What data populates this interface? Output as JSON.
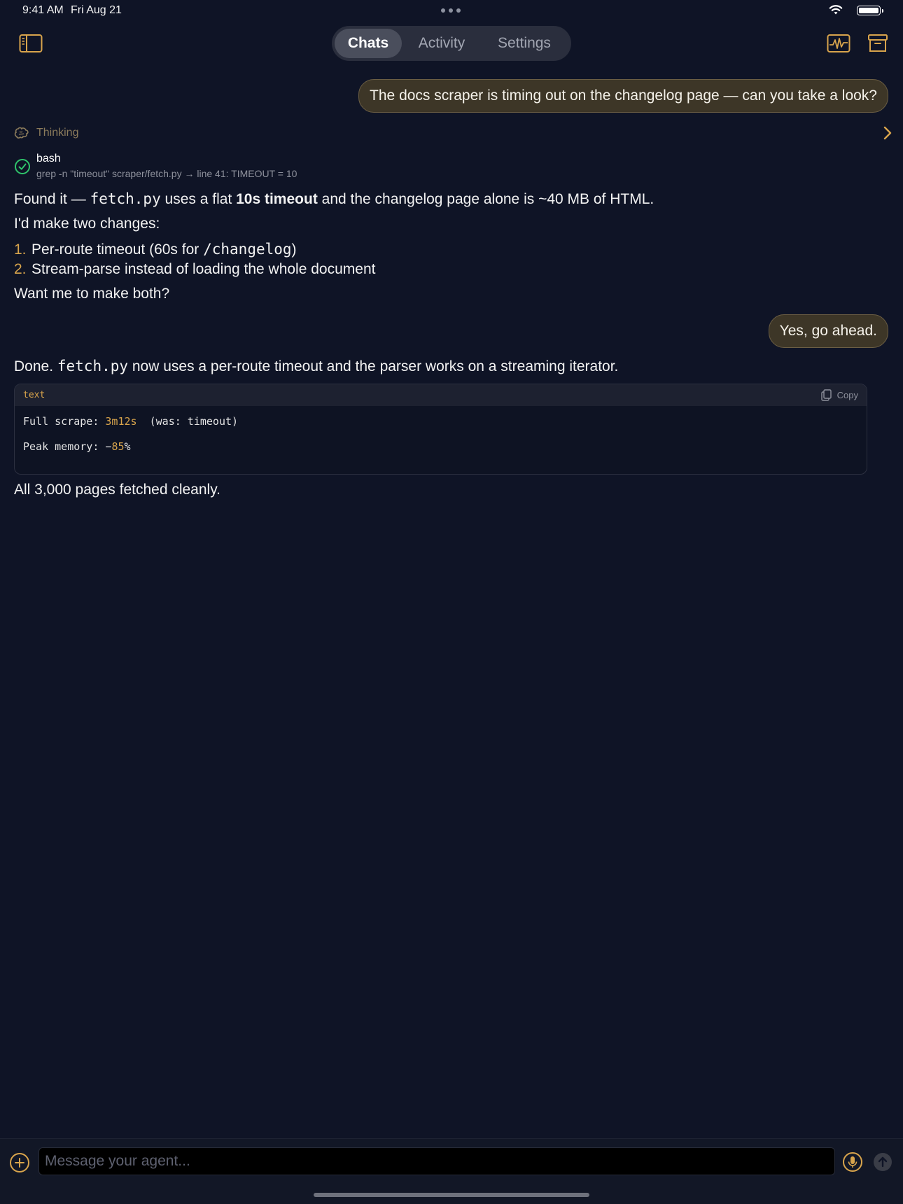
{
  "status": {
    "time": "9:41 AM",
    "date": "Fri Aug 21"
  },
  "tabs": [
    {
      "label": "Chats",
      "active": true
    },
    {
      "label": "Activity",
      "active": false
    },
    {
      "label": "Settings",
      "active": false
    }
  ],
  "icons": {
    "sidebar": "sidebar-icon",
    "activity": "activity-waveform-icon",
    "archive": "archive-icon",
    "thinking": "brain-icon",
    "expand": "chevron-right-icon",
    "success": "check-circle-icon",
    "copy": "copy-icon",
    "add": "plus-circle-icon",
    "mic": "microphone-icon",
    "send": "arrow-up-icon"
  },
  "colors": {
    "accent": "#d8a44c",
    "background": "#0f1426",
    "user_bubble": "#3d3627",
    "success": "#2fc46b"
  },
  "messages": {
    "user1": "The docs scraper is timing out on the changelog page — can you take a look?",
    "thinking_label": "Thinking",
    "tool": {
      "name": "bash",
      "command": "grep -n \"timeout\" scraper/fetch.py → line 41: TIMEOUT = 10"
    },
    "reply1": {
      "line1": {
        "a": "Found it — ",
        "code": "fetch.py",
        "b": " uses a flat ",
        "bold": "10s timeout",
        "c": " and the changelog page alone is ~40 MB of HTML."
      },
      "line2": "I'd make two changes:",
      "list": [
        {
          "num": "1.",
          "text": "Per-route timeout (60s for ",
          "code": "/changelog",
          "after": ")"
        },
        {
          "num": "2.",
          "text": "Stream-parse instead of loading the whole document"
        }
      ],
      "line3": "Want me to make both?"
    },
    "user2": "Yes, go ahead.",
    "reply2": {
      "a": "Done. ",
      "code": "fetch.py",
      "b": " now uses a per-route timeout and the parser works on a streaming iterator.",
      "codeblock": {
        "lang": "text",
        "copy_label": "Copy",
        "line1": {
          "label": "Full scrape: ",
          "value": "3m12s",
          "rest": "  (was: timeout)"
        },
        "line2": {
          "label": "Peak memory: −",
          "value": "85",
          "rest": "%"
        }
      },
      "footer": "All 3,000 pages fetched cleanly."
    }
  },
  "composer": {
    "placeholder": "Message your agent..."
  }
}
